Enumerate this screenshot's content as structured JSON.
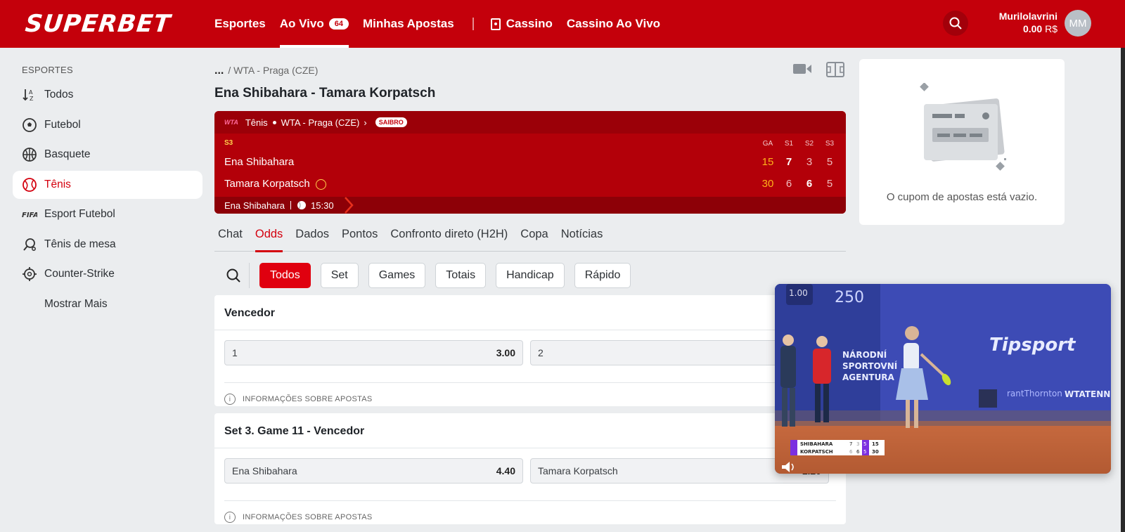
{
  "header": {
    "logo": "SUPERBET",
    "nav": [
      {
        "label": "Esportes"
      },
      {
        "label": "Ao Vivo",
        "badge": "64"
      },
      {
        "label": "Minhas Apostas"
      },
      {
        "label": "Cassino"
      },
      {
        "label": "Cassino Ao Vivo"
      }
    ],
    "user_name": "Murilolavrini",
    "balance": "0.00",
    "currency": "R$",
    "avatar_initials": "MM"
  },
  "sidebar": {
    "heading": "ESPORTES",
    "items": [
      {
        "label": "Todos",
        "icon": "sort-az-icon"
      },
      {
        "label": "Futebol",
        "icon": "soccer-ball-icon"
      },
      {
        "label": "Basquete",
        "icon": "basketball-icon"
      },
      {
        "label": "Tênis",
        "icon": "tennis-ball-icon"
      },
      {
        "label": "Esport Futebol",
        "icon": "fifa-icon"
      },
      {
        "label": "Tênis de mesa",
        "icon": "table-tennis-icon"
      },
      {
        "label": "Counter-Strike",
        "icon": "crosshair-icon"
      }
    ],
    "more": "Mostrar Mais"
  },
  "breadcrumb": {
    "ellipsis": "...",
    "sep": "/",
    "current": "WTA - Praga (CZE)"
  },
  "match": {
    "title": "Ena Shibahara - Tamara Korpatsch",
    "sport": "Tênis",
    "tournament": "WTA - Praga (CZE)",
    "wta_label": "WTA",
    "surface": "SAIBRO",
    "set_label": "S3",
    "columns": [
      "GA",
      "S1",
      "S2",
      "S3"
    ],
    "players": [
      {
        "name": "Ena Shibahara",
        "scores": [
          "15",
          "7",
          "3",
          "5"
        ]
      },
      {
        "name": "Tamara Korpatsch",
        "scores": [
          "30",
          "6",
          "6",
          "5"
        ]
      }
    ],
    "server_name": "Ena Shibahara",
    "time": "15:30"
  },
  "tabs": [
    "Chat",
    "Odds",
    "Dados",
    "Pontos",
    "Confronto direto (H2H)",
    "Copa",
    "Notícias"
  ],
  "filters": [
    "Todos",
    "Set",
    "Games",
    "Totais",
    "Handicap",
    "Rápido"
  ],
  "markets": [
    {
      "title": "Vencedor",
      "odds": [
        {
          "label": "1",
          "value": "3.00"
        },
        {
          "label": "2",
          "value": ""
        }
      ],
      "info": "INFORMAÇÕES SOBRE APOSTAS"
    },
    {
      "title": "Set 3. Game 11 - Vencedor",
      "odds": [
        {
          "label": "Ena Shibahara",
          "value": "4.40"
        },
        {
          "label": "Tamara Korpatsch",
          "value": "1.20"
        }
      ],
      "info": "INFORMAÇÕES SOBRE APOSTAS"
    }
  ],
  "betslip": {
    "empty_text": "O cupom de apostas está vazio."
  },
  "video": {
    "speed": "1.00",
    "board_number": "250",
    "sponsor": "Tipsport",
    "banner_lines": [
      "NÁRODNÍ",
      "SPORTOVNÍ",
      "AGENTURA"
    ],
    "ad_text": "rantThornton",
    "ad_text2": "WTATENNI",
    "scoreboard": [
      {
        "name": "SHIBAHARA",
        "s1": "7",
        "s2": "3",
        "s3": "5",
        "pts": "15"
      },
      {
        "name": "KORPATSCH",
        "s1": "6",
        "s2": "6",
        "s3": "5",
        "pts": "30"
      }
    ]
  },
  "colors": {
    "brand_red": "#c4000b",
    "active_red": "#e0000f",
    "score_yellow": "#ffb31a"
  }
}
